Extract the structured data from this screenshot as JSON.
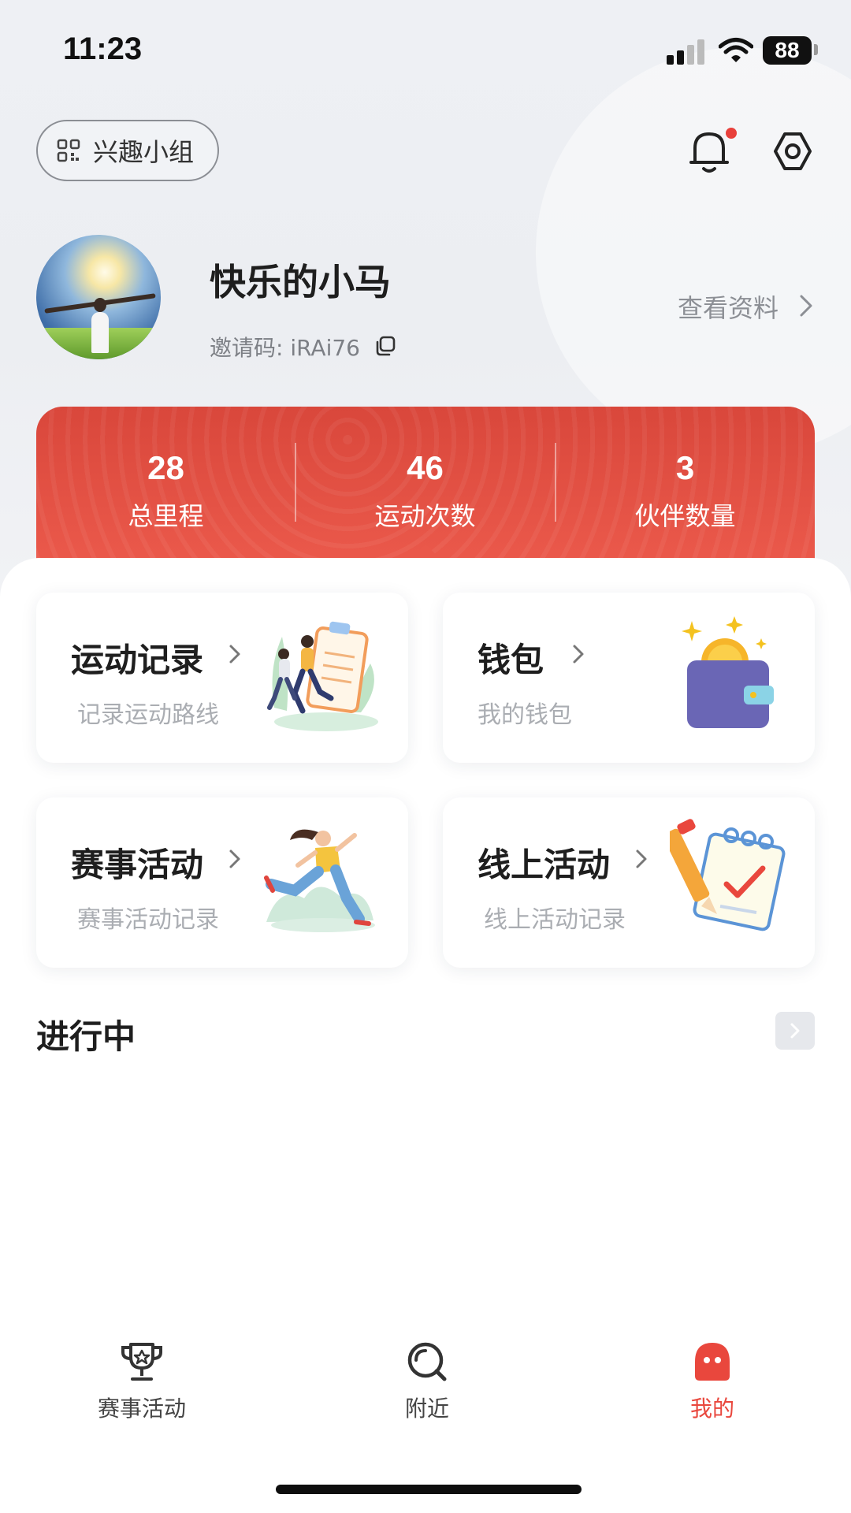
{
  "status_bar": {
    "time": "11:23",
    "battery": "88"
  },
  "header": {
    "group_label": "兴趣小组",
    "icons": {
      "group": "grid-icon",
      "notifications": "bell-icon",
      "settings": "settings-icon"
    },
    "has_unread_notification": true
  },
  "profile": {
    "name": "快乐的小马",
    "invite_code": "邀请码: iRAi76",
    "view_profile": "查看资料"
  },
  "stats": [
    {
      "value": "28",
      "label": "总里程"
    },
    {
      "value": "46",
      "label": "运动次数"
    },
    {
      "value": "3",
      "label": "伙伴数量"
    }
  ],
  "cards": [
    {
      "title": "运动记录",
      "subtitle": "记录运动路线",
      "art": "running-couple-clipboard-illustration"
    },
    {
      "title": "钱包",
      "subtitle": "我的钱包",
      "art": "wallet-coin-illustration"
    },
    {
      "title": "赛事活动",
      "subtitle": "赛事活动记录",
      "art": "running-woman-illustration"
    },
    {
      "title": "线上活动",
      "subtitle": "线上活动记录",
      "art": "notepad-pencil-illustration"
    }
  ],
  "in_progress": {
    "title": "进行中"
  },
  "tab_bar": {
    "tabs": [
      {
        "label": "赛事活动",
        "icon": "trophy-icon"
      },
      {
        "label": "附近",
        "icon": "nearby-search-icon"
      },
      {
        "label": "我的",
        "icon": "profile-ghost-icon"
      }
    ],
    "active_index": 2
  },
  "colors": {
    "accent": "#e9473d",
    "stats_card": "#e5503f",
    "background": "#eef0f4"
  }
}
